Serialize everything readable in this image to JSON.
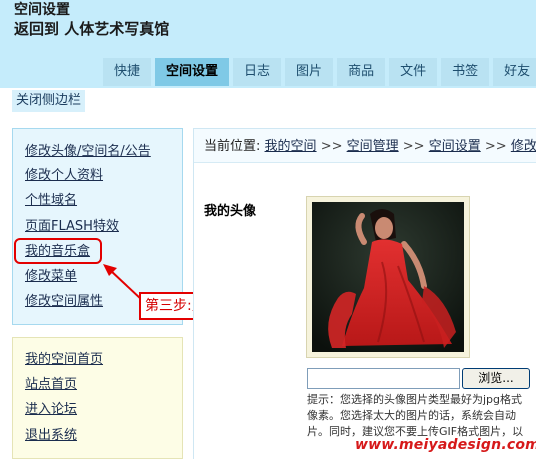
{
  "header": {
    "title": "空间设置",
    "subtitle": "返回到 人体艺术写真馆",
    "tabs": [
      {
        "label": "快捷",
        "active": false
      },
      {
        "label": "空间设置",
        "active": true
      },
      {
        "label": "日志",
        "active": false
      },
      {
        "label": "图片",
        "active": false
      },
      {
        "label": "商品",
        "active": false
      },
      {
        "label": "文件",
        "active": false
      },
      {
        "label": "书签",
        "active": false
      },
      {
        "label": "好友",
        "active": false
      }
    ]
  },
  "toggle_sidebar": "关闭侧边栏",
  "sidebar": {
    "settings_links": [
      "修改头像/空间名/公告",
      "修改个人资料",
      "个性域名",
      "页面FLASH特效",
      "我的音乐盒",
      "修改菜单",
      "修改空间属性"
    ],
    "nav_links": [
      "我的空间首页",
      "站点首页",
      "进入论坛",
      "退出系统"
    ]
  },
  "callout": "第三步:点这里",
  "breadcrumb": {
    "prefix": "当前位置:",
    "items": [
      "我的空间",
      "空间管理",
      "空间设置",
      "修改"
    ],
    "separator": ">>"
  },
  "avatar": {
    "label": "我的头像",
    "browse_label": "浏览...",
    "hint_lines": [
      "提示：您选择的头像图片类型最好为jpg格式",
      "像素。您选择太大的图片的话，系统会自动",
      "片。同时，建议您不要上传GIF格式图片，以"
    ]
  },
  "watermark": "www.meiyadesign.com",
  "colors": {
    "header_bg": "#c5ecfb",
    "tab_active": "#7fc9e6",
    "highlight_red": "#e30000",
    "watermark": "#d6191a"
  }
}
